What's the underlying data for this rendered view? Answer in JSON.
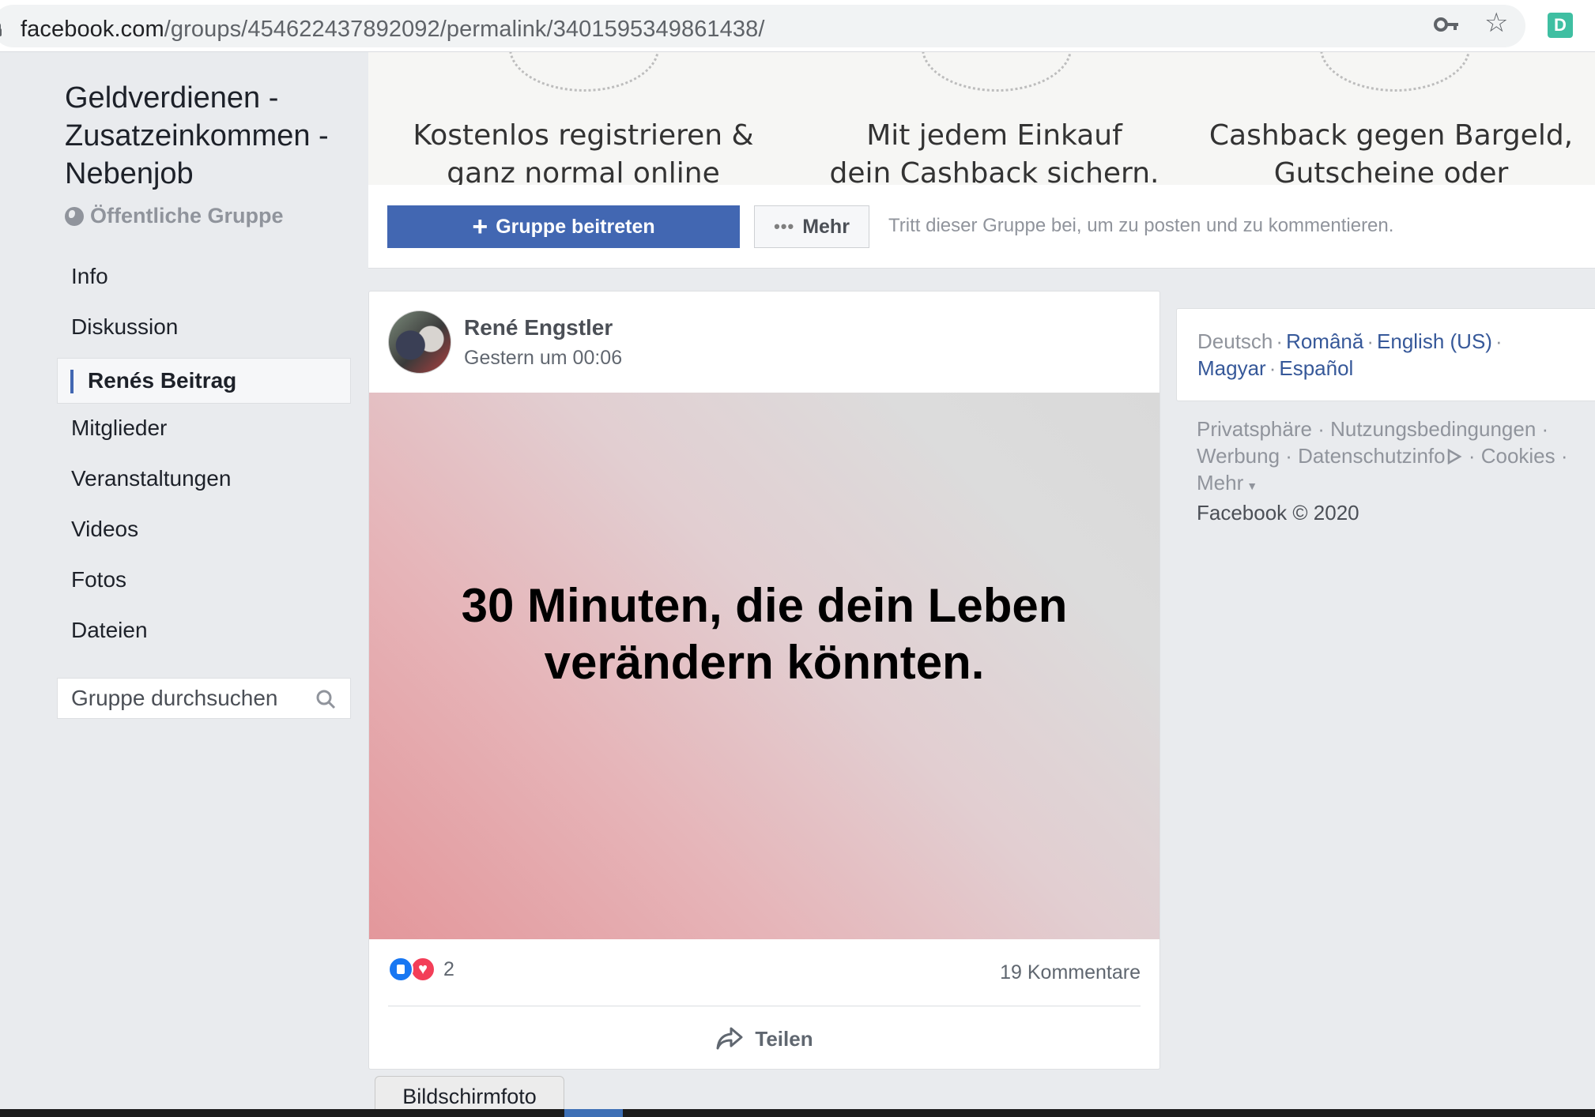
{
  "browser": {
    "url_domain": "facebook.com",
    "url_path": "/groups/454622437892092/permalink/3401595349861438/",
    "extension_letter": "D"
  },
  "sidebar": {
    "group_name": "Geldverdienen - Zusatzeinkommen - Nebenjob",
    "group_type": "Öffentliche Gruppe",
    "nav": [
      {
        "label": "Info"
      },
      {
        "label": "Diskussion"
      },
      {
        "label": "Renés Beitrag",
        "active": true
      },
      {
        "label": "Mitglieder"
      },
      {
        "label": "Veranstaltungen"
      },
      {
        "label": "Videos"
      },
      {
        "label": "Fotos"
      },
      {
        "label": "Dateien"
      }
    ],
    "search_placeholder": "Gruppe durchsuchen"
  },
  "cover": {
    "captions": [
      {
        "line1": "Kostenlos registrieren &",
        "line2": "ganz normal online"
      },
      {
        "line1": "Mit jedem Einkauf",
        "line2": "dein Cashback sichern."
      },
      {
        "line1": "Cashback gegen Bargeld,",
        "line2": "Gutscheine oder"
      }
    ],
    "join_label": "Gruppe beitreten",
    "more_label": "Mehr",
    "join_hint": "Tritt dieser Gruppe bei, um zu posten und zu kommentieren."
  },
  "post": {
    "author": "René Engstler",
    "timestamp": "Gestern um 00:06",
    "image_text_line1": "30 Minuten, die dein Leben",
    "image_text_line2": "verändern könnten.",
    "reaction_count": "2",
    "comments": "19 Kommentare",
    "share_label": "Teilen"
  },
  "right": {
    "languages": {
      "current": "Deutsch",
      "line1_links": [
        "Română",
        "English (US)"
      ],
      "line2_links": [
        "Magyar",
        "Español"
      ]
    },
    "footer": {
      "row1": [
        "Privatsphäre",
        "Nutzungsbedingungen"
      ],
      "row2": [
        "Werbung",
        "Datenschutzinfo",
        "Cookies"
      ],
      "more": "Mehr",
      "copyright": "Facebook © 2020"
    }
  },
  "screenshot_label": "Bildschirmfoto",
  "colors": {
    "brand_blue": "#4267b2",
    "link_blue": "#365899",
    "page_bg": "#e9ebee"
  }
}
